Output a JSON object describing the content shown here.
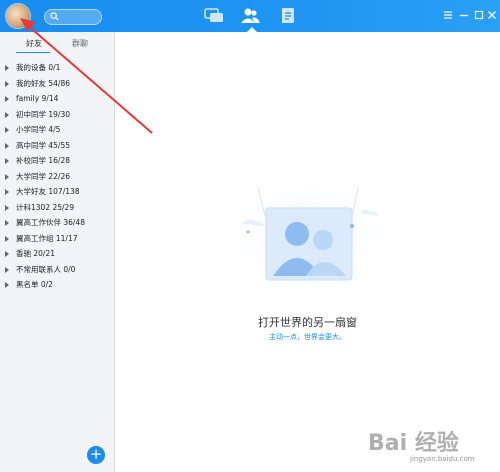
{
  "group_tabs": {
    "friends": "好友",
    "groups": "群聊"
  },
  "contact_groups": [
    {
      "label": "我的设备 0/1"
    },
    {
      "label": "我的好友 54/86"
    },
    {
      "label": "family 9/14"
    },
    {
      "label": "初中同学 19/30"
    },
    {
      "label": "小学同学 4/5"
    },
    {
      "label": "高中同学 45/55"
    },
    {
      "label": "补校同学 16/28"
    },
    {
      "label": "大学同学 22/26"
    },
    {
      "label": "大学好友 107/138"
    },
    {
      "label": "计科1302 25/29"
    },
    {
      "label": "翼高工作伙伴 36/48"
    },
    {
      "label": "翼高工作组 11/17"
    },
    {
      "label": "香驰 20/21"
    },
    {
      "label": "不常用联系人 0/0"
    },
    {
      "label": "黑名单 0/2"
    }
  ],
  "add_button": "+",
  "main": {
    "title": "打开世界的另一扇窗",
    "subtitle": "主动一点，世界会更大。"
  },
  "watermark": {
    "brand": "Bai 经验",
    "url": "jingyan.baidu.com"
  },
  "colors": {
    "accent": "#1a8df0",
    "annotation_arrow": "#e53935"
  },
  "icons": {
    "search": "search-icon",
    "chat": "chat-icon",
    "contacts": "contacts-icon",
    "files": "file-icon",
    "add": "plus-icon"
  }
}
